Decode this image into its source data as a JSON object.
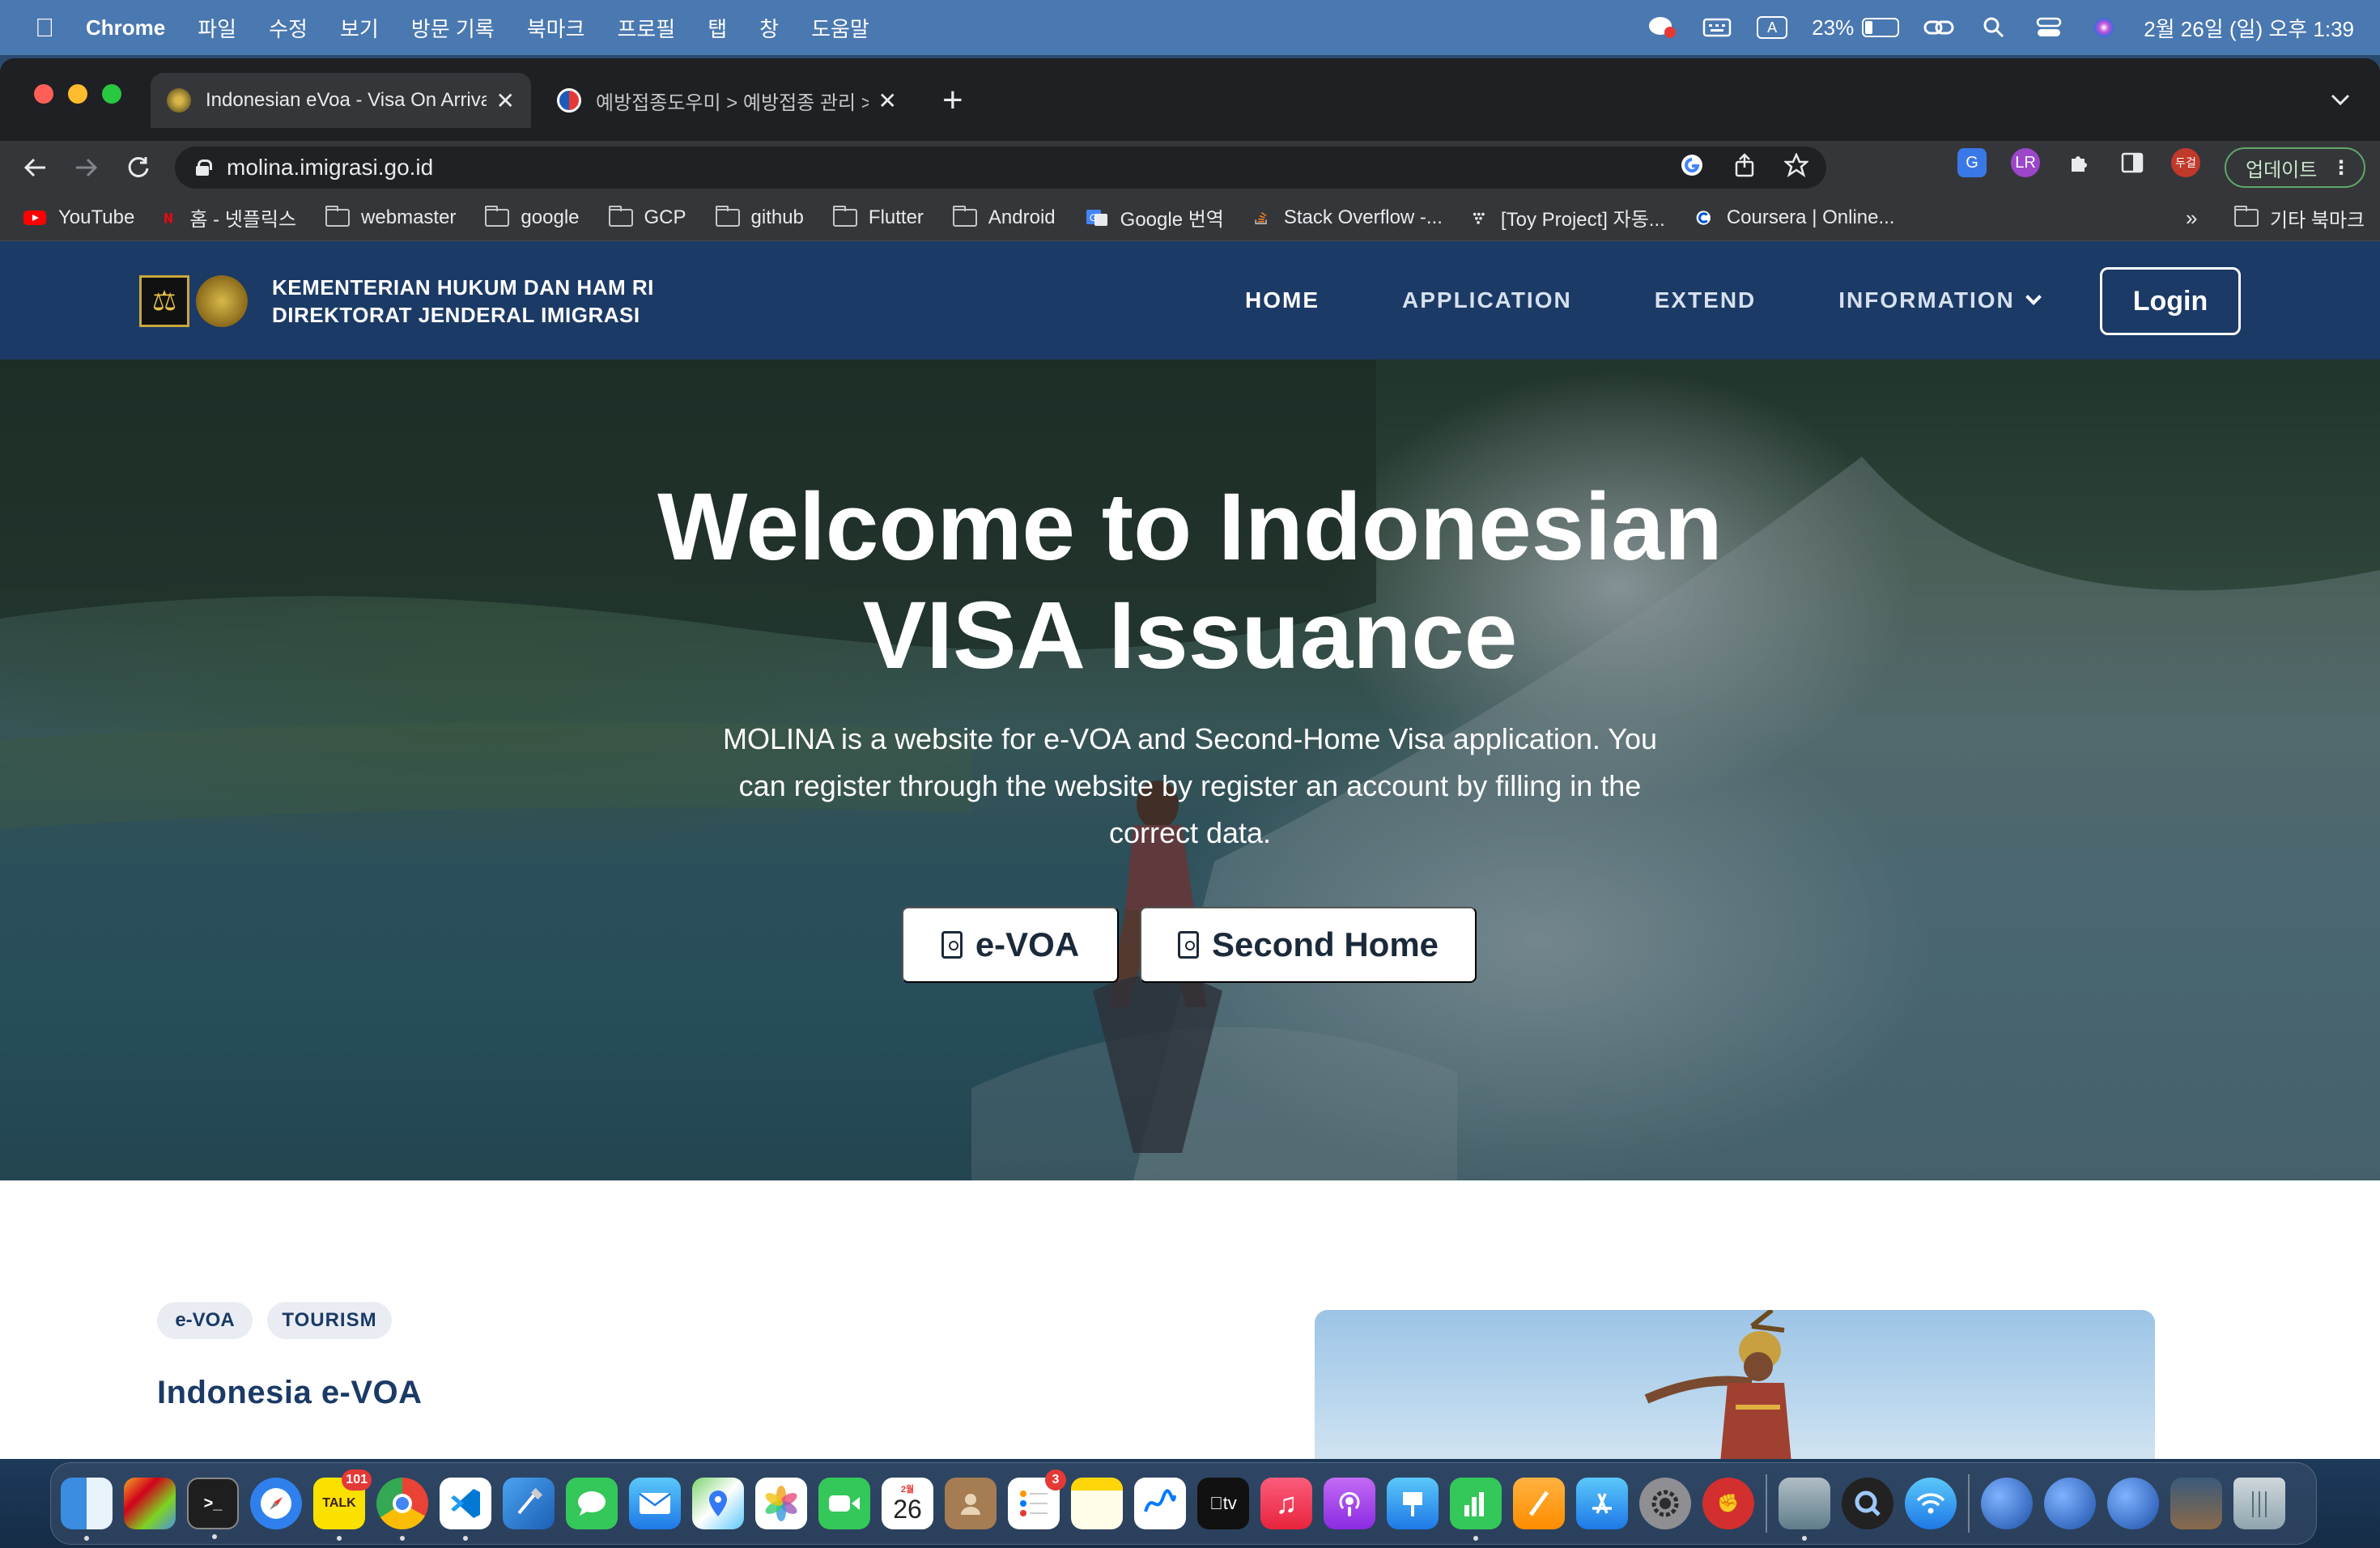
{
  "menubar": {
    "app_name": "Chrome",
    "items": [
      "파일",
      "수정",
      "보기",
      "방문 기록",
      "북마크",
      "프로필",
      "탭",
      "창",
      "도움말"
    ],
    "input_source": "A",
    "battery_percent": "23%",
    "battery_level": 0.23,
    "datetime": "2월 26일 (일) 오후 1:39"
  },
  "browser": {
    "tabs": [
      {
        "title": "Indonesian eVoa - Visa On Arrival",
        "active": true
      },
      {
        "title": "예방접종도우미 > 예방접종 관리 > 조회",
        "active": false
      }
    ],
    "url": "molina.imigrasi.go.id",
    "profile_label": "두걸",
    "update_label": "업데이트",
    "bookmarks": [
      {
        "label": "YouTube",
        "icon": "youtube-icon"
      },
      {
        "label": "홈 - 넷플릭스",
        "icon": "netflix-icon"
      },
      {
        "label": "webmaster",
        "icon": "folder-icon"
      },
      {
        "label": "google",
        "icon": "folder-icon"
      },
      {
        "label": "GCP",
        "icon": "folder-icon"
      },
      {
        "label": "github",
        "icon": "folder-icon"
      },
      {
        "label": "Flutter",
        "icon": "folder-icon"
      },
      {
        "label": "Android",
        "icon": "folder-icon"
      },
      {
        "label": "Google 번역",
        "icon": "google-translate-icon"
      },
      {
        "label": "Stack Overflow -...",
        "icon": "stackoverflow-icon"
      },
      {
        "label": "[Toy Project] 자동...",
        "icon": "toy-project-icon"
      },
      {
        "label": "Coursera | Online...",
        "icon": "coursera-icon"
      }
    ],
    "bookmarks_overflow": "»",
    "other_bookmarks": "기타 북마크"
  },
  "site": {
    "ministry_line1": "KEMENTERIAN HUKUM DAN HAM RI",
    "ministry_line2": "DIREKTORAT JENDERAL IMIGRASI",
    "nav": [
      "HOME",
      "APPLICATION",
      "EXTEND",
      "INFORMATION"
    ],
    "login": "Login",
    "hero_title_line1": "Welcome to Indonesian",
    "hero_title_line2": "VISA Issuance",
    "hero_desc": "MOLINA is a website for e-VOA and Second-Home Visa application. You can register through the website by register an account by filling in the correct data.",
    "btn_evoa": "e-VOA",
    "btn_second_home": "Second Home",
    "tags": [
      "e-VOA",
      "TOURISM"
    ],
    "section_title": "Indonesia e-VOA"
  },
  "dock": {
    "kakao_badge": "101",
    "calendar_month": "2월",
    "calendar_day": "26",
    "reminders_badge": "3",
    "tv_label": "tv"
  },
  "colors": {
    "site_nav": "#1b3a66",
    "menubar": "#4a78b0",
    "accent_green": "#5fa86a"
  }
}
